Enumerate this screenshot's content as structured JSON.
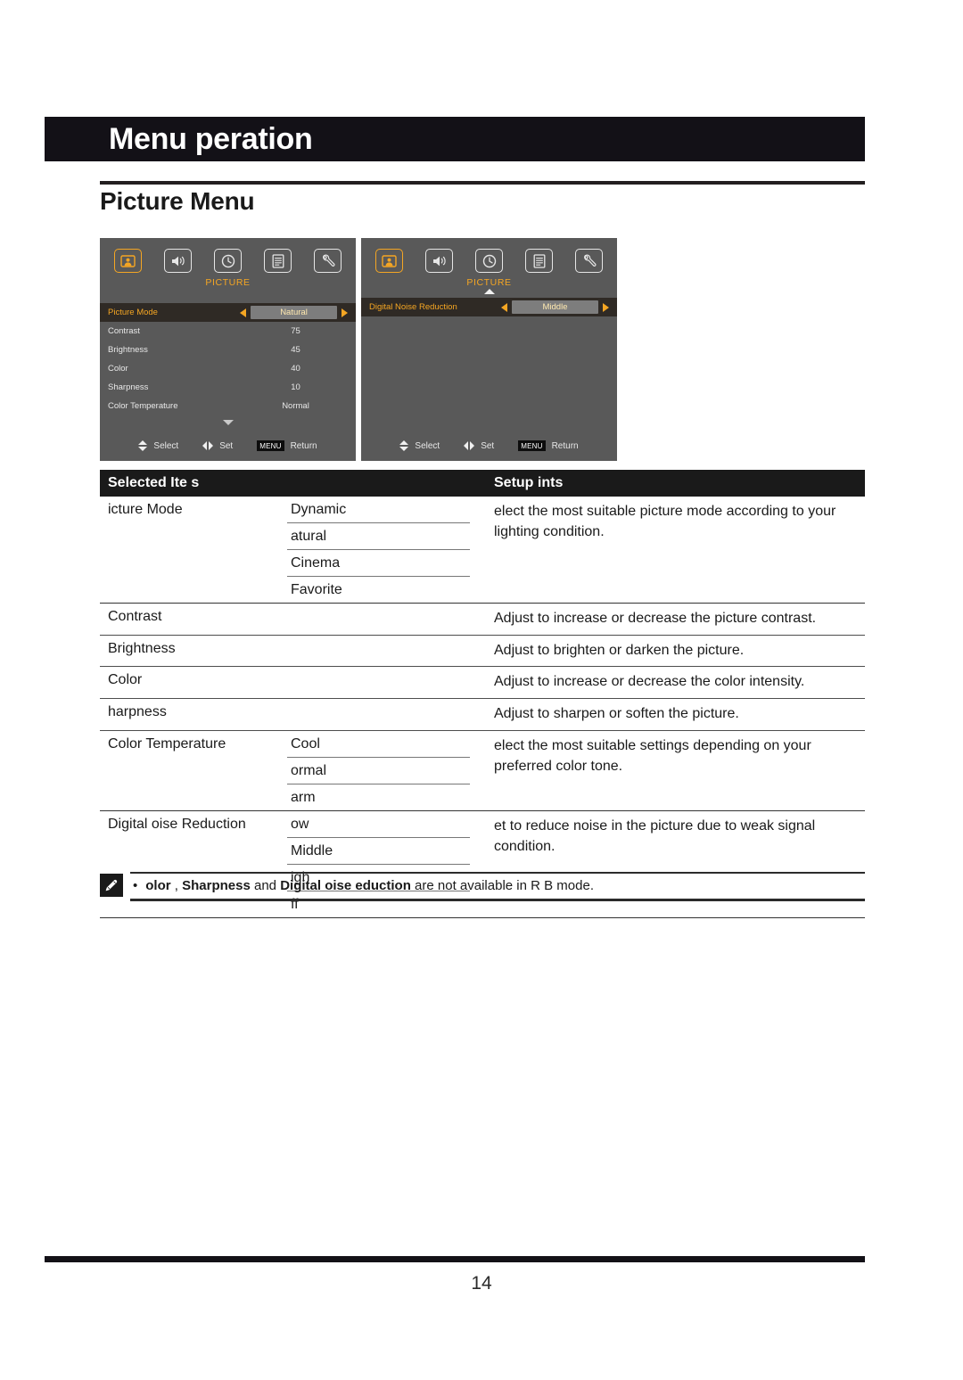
{
  "page": {
    "banner_title": "Menu  peration",
    "section_title": "Picture Menu",
    "page_number": "14"
  },
  "osd_panels": [
    {
      "category": "PICTURE",
      "icons": [
        "picture-icon",
        "sound-icon",
        "time-icon",
        "option-icon",
        "setup-icon"
      ],
      "active_icon_index": 0,
      "show_up_arrow": false,
      "rows": [
        {
          "label": "Picture Mode",
          "value": "Natural",
          "selected": true
        },
        {
          "label": "Contrast",
          "value": "75",
          "selected": false
        },
        {
          "label": "Brightness",
          "value": "45",
          "selected": false
        },
        {
          "label": "Color",
          "value": "40",
          "selected": false
        },
        {
          "label": "Sharpness",
          "value": "10",
          "selected": false
        },
        {
          "label": "Color Temperature",
          "value": "Normal",
          "selected": false
        }
      ],
      "show_down_arrow": true,
      "footer": {
        "select": "Select",
        "set": "Set",
        "menu_key": "MENU",
        "return": "Return"
      }
    },
    {
      "category": "PICTURE",
      "icons": [
        "picture-icon",
        "sound-icon",
        "time-icon",
        "option-icon",
        "setup-icon"
      ],
      "active_icon_index": 0,
      "show_up_arrow": true,
      "rows": [
        {
          "label": "Digital Noise Reduction",
          "value": "Middle",
          "selected": true
        }
      ],
      "show_down_arrow": false,
      "footer": {
        "select": "Select",
        "set": "Set",
        "menu_key": "MENU",
        "return": "Return"
      }
    }
  ],
  "table": {
    "headers": {
      "items": "Selected Ite s",
      "points": "Setup  ints"
    },
    "rows": [
      {
        "item": " icture Mode",
        "options": [
          "Dynamic",
          " atural",
          "Cinema",
          "Favorite"
        ],
        "description": " elect the most suitable picture mode according to your lighting condition."
      },
      {
        "item": "Contrast",
        "options": [],
        "description": "Adjust to increase or decrease the picture contrast."
      },
      {
        "item": "Brightness",
        "options": [],
        "description": "Adjust to brighten or darken the picture."
      },
      {
        "item": "Color",
        "options": [],
        "description": "Adjust to increase or decrease the color intensity."
      },
      {
        "item": " harpness",
        "options": [],
        "description": "Adjust to sharpen or soften the picture."
      },
      {
        "item": "Color Temperature",
        "options": [
          "Cool",
          " ormal",
          " arm"
        ],
        "description": " elect the most suitable settings depending on your preferred color tone."
      },
      {
        "item": "Digital  oise Reduction",
        "options": [
          " ow",
          "Middle",
          " igh",
          " ff"
        ],
        "description": " et to reduce noise in the picture due to weak signal condition."
      }
    ]
  },
  "note": {
    "bullet": "•",
    "part1": " olor ",
    "part2": ", ",
    "part3": "Sharpness",
    "part4": " and ",
    "part5": "Digital  oise  eduction",
    "part6": " are not available in R B mode."
  }
}
